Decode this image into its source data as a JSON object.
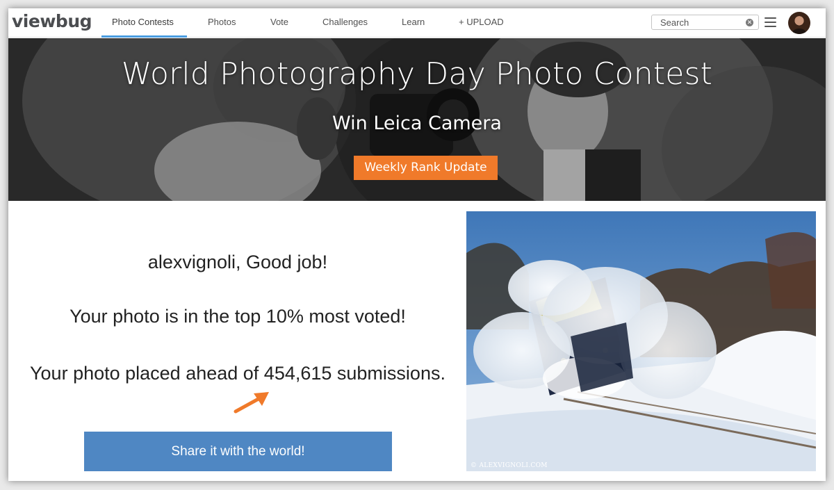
{
  "navbar": {
    "logo": "viewbug",
    "items": [
      {
        "label": "Photo Contests",
        "active": true
      },
      {
        "label": "Photos"
      },
      {
        "label": "Vote"
      },
      {
        "label": "Challenges"
      },
      {
        "label": "Learn"
      },
      {
        "label": "+ UPLOAD"
      }
    ],
    "search_placeholder": "Search",
    "active_color": "#4a9de1"
  },
  "hero": {
    "title": "World Photography Day Photo Contest",
    "subtitle": "Win Leica Camera",
    "button_label": "Weekly Rank Update",
    "button_color": "#f07a2a"
  },
  "result": {
    "greeting": "alexvignoli, Good job!",
    "rank_message": "Your photo is in the top 10% most voted!",
    "placement_message": "Your photo placed ahead of 454,615 submissions.",
    "share_label": "Share it with the world!",
    "share_color": "#4f87c3",
    "arrow_color": "#f07a2a"
  },
  "photo": {
    "credit": "© ALEXVIGNOLI.COM"
  },
  "icons": {
    "clear": "clear-icon",
    "menu": "hamburger-menu-icon",
    "arrow": "arrow-up-right-icon"
  }
}
